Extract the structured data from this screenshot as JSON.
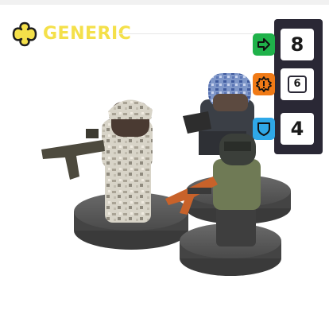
{
  "faction": {
    "label": "GENERIC",
    "icon": "clover-icon",
    "color": "#f4e04a"
  },
  "stats": [
    {
      "key": "move",
      "icon": "arrow-right-icon",
      "color": "#1fb24a",
      "value": "8",
      "boxed": false
    },
    {
      "key": "skill",
      "icon": "gear-alert-icon",
      "color": "#f07a16",
      "value": "6",
      "boxed": true
    },
    {
      "key": "defense",
      "icon": "shield-icon",
      "color": "#2fa8e8",
      "value": "4",
      "boxed": false
    }
  ],
  "colors": {
    "panel": "#2a2835",
    "base": "#545454"
  }
}
